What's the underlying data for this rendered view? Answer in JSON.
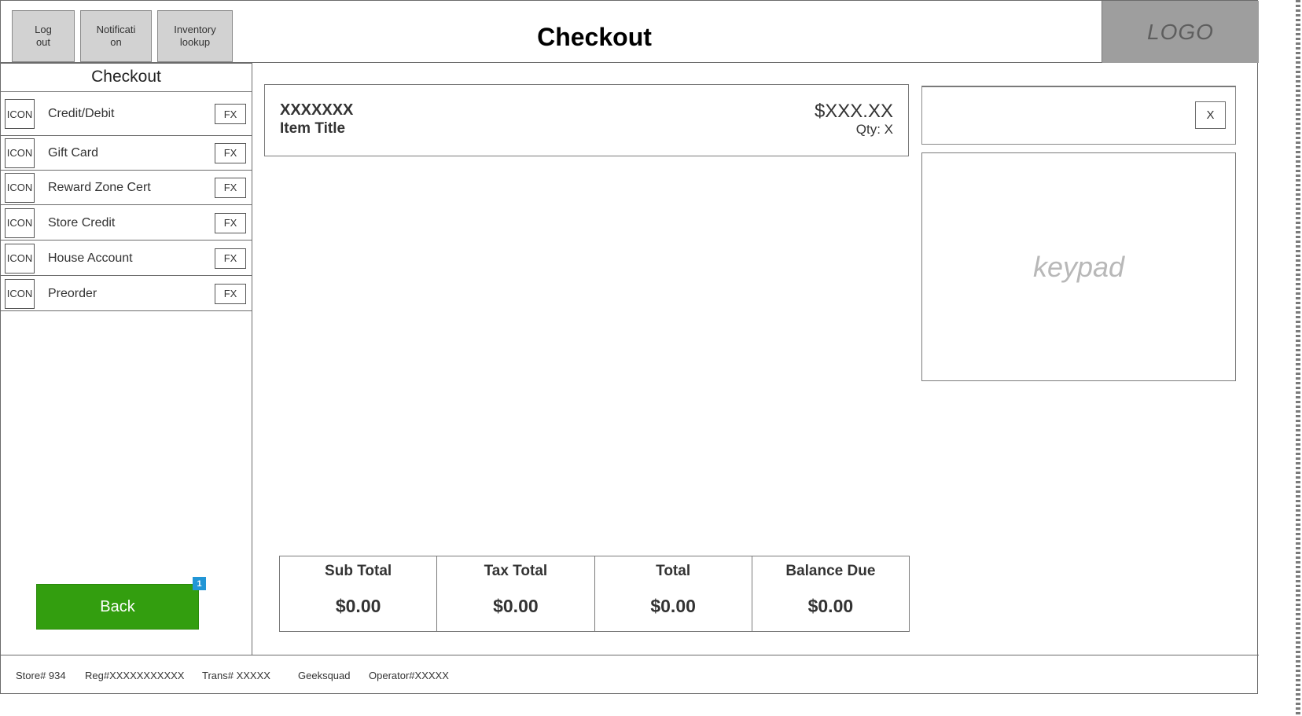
{
  "header": {
    "buttons": [
      {
        "line1": "Log",
        "line2": "out"
      },
      {
        "line1": "Notificati",
        "line2": "on"
      },
      {
        "line1": "Inventory",
        "line2": "lookup"
      }
    ],
    "title": "Checkout",
    "logo": "LOGO"
  },
  "sidebar": {
    "title": "Checkout",
    "items": [
      {
        "icon": "ICON",
        "label": "Credit/Debit",
        "fx": "FX"
      },
      {
        "icon": "ICON",
        "label": "Gift Card",
        "fx": "FX"
      },
      {
        "icon": "ICON",
        "label": "Reward Zone Cert",
        "fx": "FX"
      },
      {
        "icon": "ICON",
        "label": "Store Credit",
        "fx": "FX"
      },
      {
        "icon": "ICON",
        "label": "House Account",
        "fx": "FX"
      },
      {
        "icon": "ICON",
        "label": "Preorder",
        "fx": "FX"
      }
    ],
    "back_label": "Back",
    "back_badge": "1"
  },
  "cart": {
    "item": {
      "sku": "XXXXXXX",
      "title": "Item Title",
      "price": "$XXX.XX",
      "qty": "Qty: X"
    }
  },
  "totals": [
    {
      "label": "Sub Total",
      "value": "$0.00"
    },
    {
      "label": "Tax Total",
      "value": "$0.00"
    },
    {
      "label": "Total",
      "value": "$0.00"
    },
    {
      "label": "Balance Due",
      "value": "$0.00"
    }
  ],
  "entry": {
    "clear_label": "X",
    "keypad_label": "keypad"
  },
  "footer": {
    "store": "Store# 934",
    "reg": "Reg#XXXXXXXXXXX",
    "trans": "Trans#  XXXXX",
    "dept": "Geeksquad",
    "operator": "Operator#XXXXX"
  },
  "colors": {
    "back_button": "#339e0f",
    "badge": "#2296d6",
    "logo_bg": "#9e9e9e",
    "header_button_bg": "#d2d2d2"
  }
}
